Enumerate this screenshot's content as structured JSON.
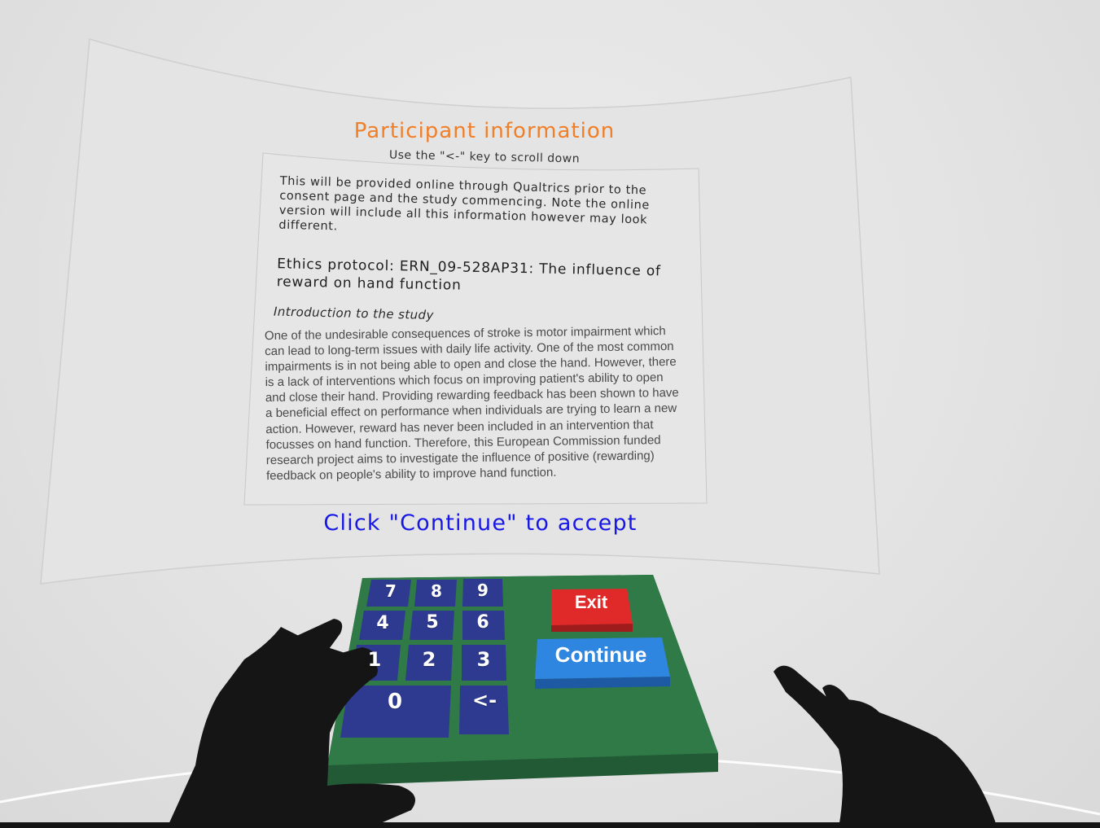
{
  "panel": {
    "title": "Participant information",
    "scroll_hint": "Use the \"<-\" key to scroll down",
    "intro_text": "This will be provided online through Qualtrics prior to the consent page and the study commencing. Note the online version will include all this information however may look different.",
    "ethics_heading": "Ethics protocol: ERN_09-528AP31: The influence of reward on hand function",
    "section_heading": "Introduction to the study",
    "section_body": "One of the undesirable consequences of stroke is motor impairment which can lead to long-term issues with daily life activity. One of the most common impairments is in not being able to open and close the hand. However, there is a lack of interventions which focus on improving patient's ability to open and close their hand. Providing rewarding feedback has been shown to have a beneficial effect on performance when individuals are trying to learn a new action. However, reward has never been included in an intervention that focusses on hand function. Therefore, this European Commission funded research project aims to investigate the influence of positive (rewarding) feedback on people's ability to improve hand function.",
    "call_to_action": "Click \"Continue\" to accept"
  },
  "keypad": {
    "keys": {
      "k7": "7",
      "k8": "8",
      "k9": "9",
      "k4": "4",
      "k5": "5",
      "k6": "6",
      "k1": "1",
      "k2": "2",
      "k3": "3",
      "k0": "0",
      "back": "<-"
    },
    "exit_label": "Exit",
    "continue_label": "Continue"
  },
  "colors": {
    "title": "#f07f2a",
    "call_to_action": "#1717e6",
    "keypad_base": "#2f7a47",
    "key_face": "#2d3a8f",
    "exit_button": "#e02a2a",
    "continue_button": "#2f86e0"
  }
}
